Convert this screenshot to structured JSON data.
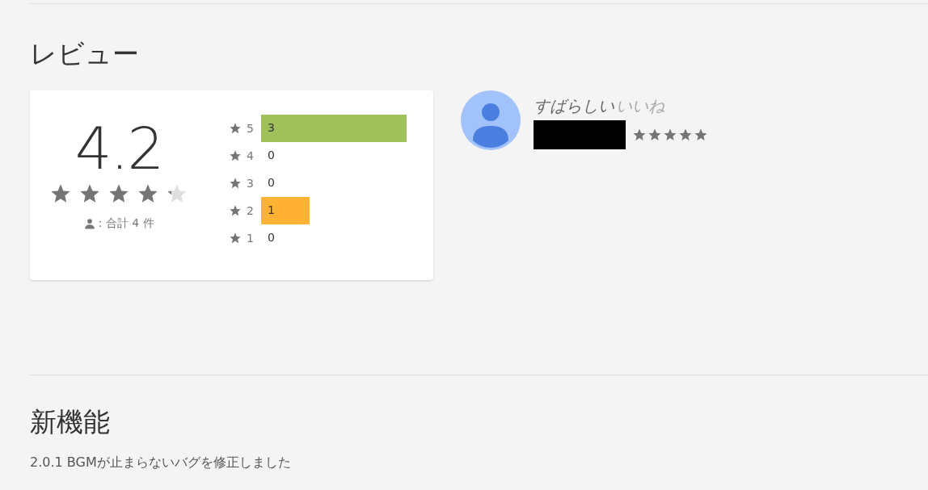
{
  "reviews_section": {
    "heading": "レビュー",
    "summary": {
      "average": "4.2",
      "stars": 4.2,
      "total_label": ": 合計",
      "total_count": "4",
      "total_unit": "件"
    },
    "histogram": [
      {
        "stars_label": "5",
        "count": "3"
      },
      {
        "stars_label": "4",
        "count": "0"
      },
      {
        "stars_label": "3",
        "count": "0"
      },
      {
        "stars_label": "2",
        "count": "1"
      },
      {
        "stars_label": "1",
        "count": "0"
      }
    ],
    "review": {
      "title": "すばらしい",
      "body": "いいね",
      "author_redacted": true,
      "stars": 5
    }
  },
  "whats_new": {
    "heading": "新機能",
    "text": "2.0.1 BGMが止まらないバグを修正しました"
  }
}
